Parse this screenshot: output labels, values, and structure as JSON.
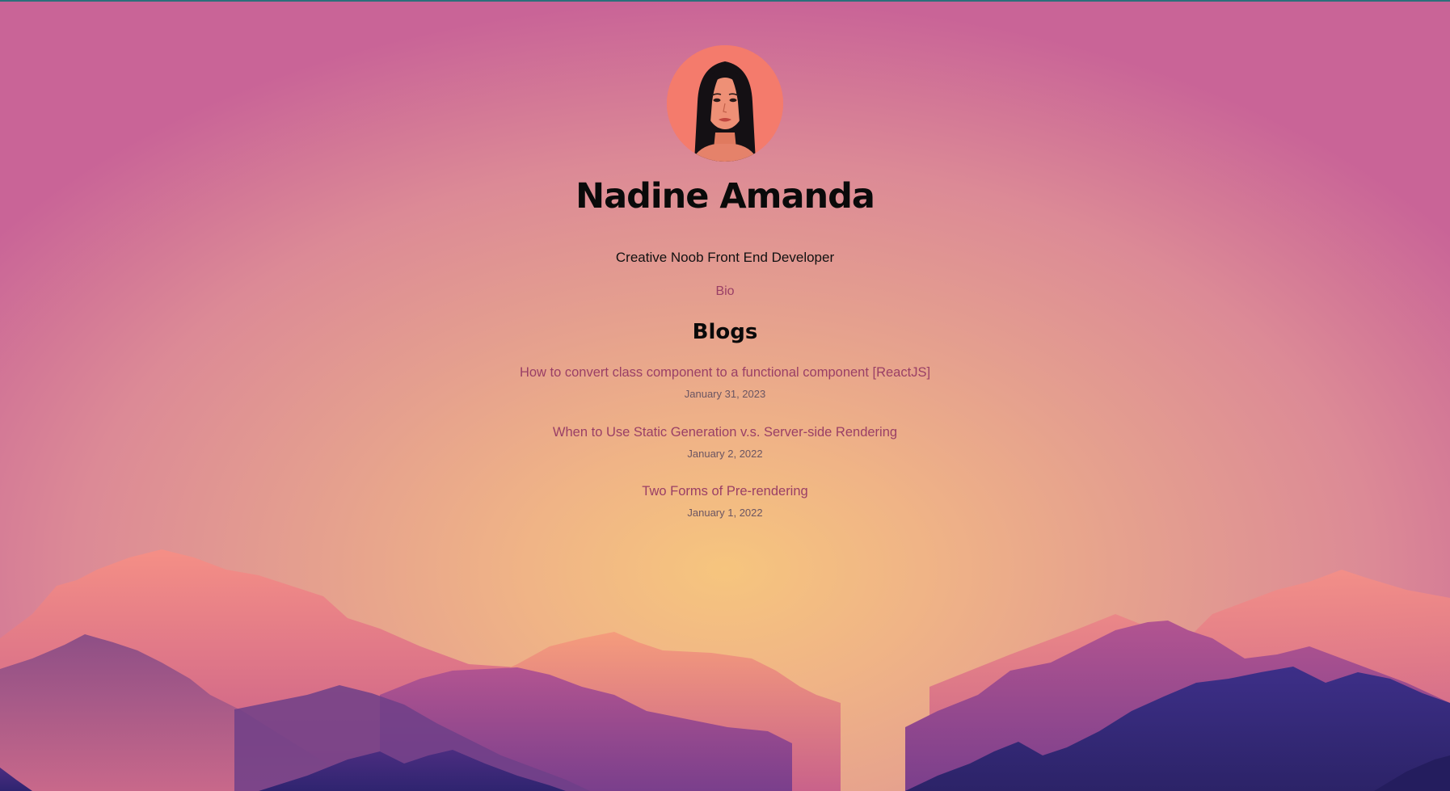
{
  "profile": {
    "name": "Nadine Amanda",
    "tagline": "Creative Noob Front End Developer",
    "bio_link": "Bio"
  },
  "blogs": {
    "heading": "Blogs",
    "posts": [
      {
        "title": "How to convert class component to a functional component [ReactJS]",
        "date": "January 31, 2023"
      },
      {
        "title": "When to Use Static Generation v.s. Server-side Rendering",
        "date": "January 2, 2022"
      },
      {
        "title": "Two Forms of Pre-rendering",
        "date": "January 1, 2022"
      }
    ]
  },
  "colors": {
    "link": "#9a3f66",
    "sky_center": "#f6c57e",
    "sky_edge": "#c96497",
    "mountain_dark": "#3a2a7a",
    "avatar_bg": "#f47b6c"
  }
}
